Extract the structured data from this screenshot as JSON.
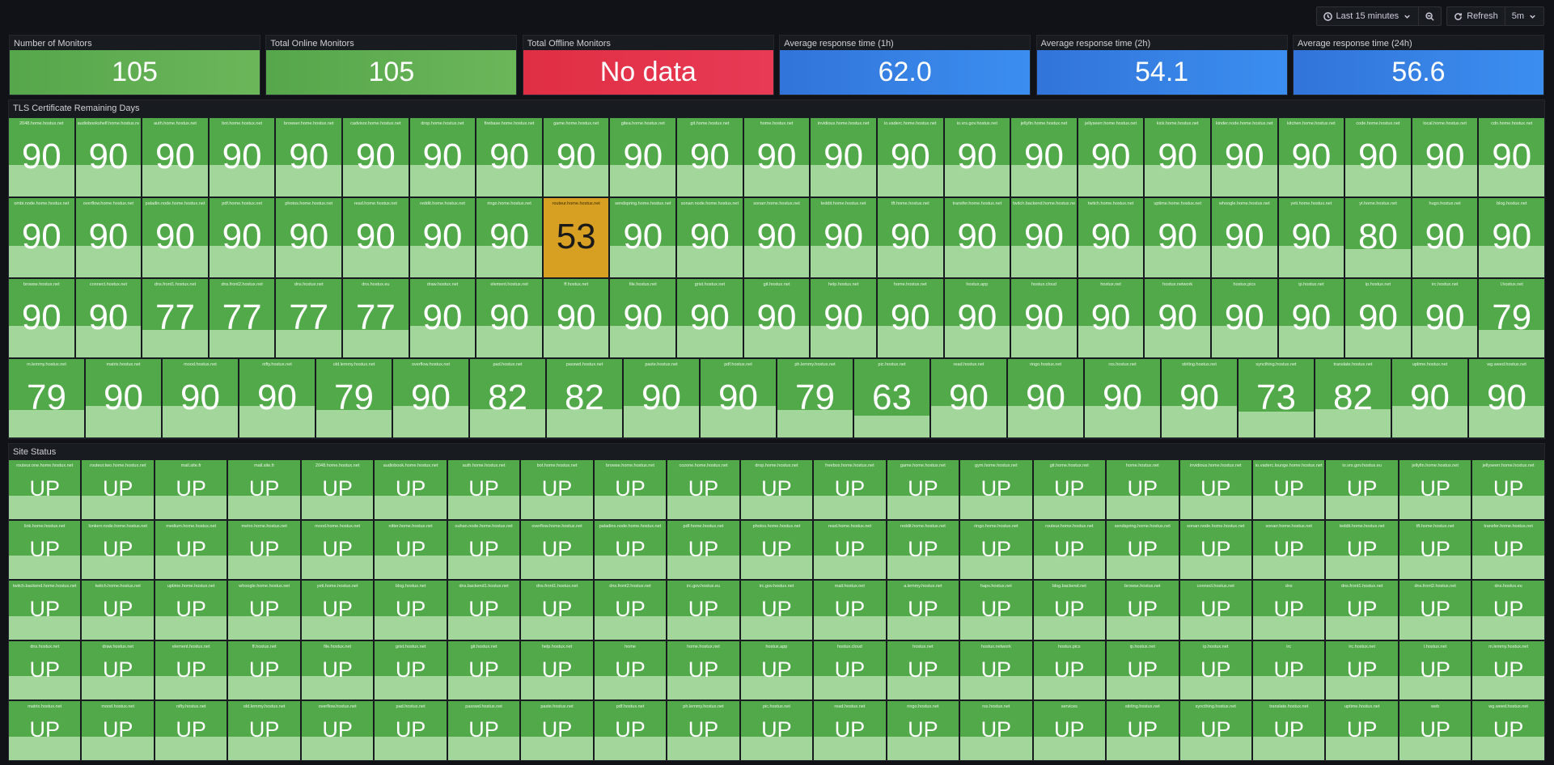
{
  "toolbar": {
    "time_range": "Last 15 minutes",
    "refresh_label": "Refresh",
    "refresh_interval": "5m"
  },
  "stats": [
    {
      "title": "Number of Monitors",
      "value": "105",
      "color": "#56a64b"
    },
    {
      "title": "Total Online Monitors",
      "value": "105",
      "color": "#56a64b"
    },
    {
      "title": "Total Offline Monitors",
      "value": "No data",
      "color": "#e02f44"
    },
    {
      "title": "Average response time (1h)",
      "value": "62.0",
      "color": "#3274d9"
    },
    {
      "title": "Average response time (2h)",
      "value": "54.1",
      "color": "#3274d9"
    },
    {
      "title": "Average response time (24h)",
      "value": "56.6",
      "color": "#3274d9"
    }
  ],
  "tls": {
    "title": "TLS Certificate Remaining Days",
    "rows": [
      [
        {
          "n": "2048.home.hostux.net",
          "v": "90"
        },
        {
          "n": "audiobookshelf.home.hostux.net",
          "v": "90"
        },
        {
          "n": "auth.home.hostux.net",
          "v": "90"
        },
        {
          "n": "bot.home.hostux.net",
          "v": "90"
        },
        {
          "n": "browser.home.hostux.net",
          "v": "90"
        },
        {
          "n": "cadvisor.home.hostux.net",
          "v": "90"
        },
        {
          "n": "drop.home.hostux.net",
          "v": "90"
        },
        {
          "n": "firebase.home.hostux.net",
          "v": "90"
        },
        {
          "n": "game.home.hostux.net",
          "v": "90"
        },
        {
          "n": "gitea.home.hostux.net",
          "v": "90"
        },
        {
          "n": "git.home.hostux.net",
          "v": "90"
        },
        {
          "n": "home.hostux.net",
          "v": "90"
        },
        {
          "n": "invidious.home.hostux.net",
          "v": "90"
        },
        {
          "n": "io.vaderc.home.hostux.net",
          "v": "90"
        },
        {
          "n": "io.vrs.gov.hostux.net",
          "v": "90"
        },
        {
          "n": "jellyfin.home.hostux.net",
          "v": "90"
        },
        {
          "n": "jellyseerr.home.hostux.net",
          "v": "90"
        },
        {
          "n": "kick.home.hostux.net",
          "v": "90"
        },
        {
          "n": "kinder.node.home.hostux.net",
          "v": "90"
        },
        {
          "n": "kitchen.home.hostux.net",
          "v": "90"
        },
        {
          "n": "code.home.hostux.net",
          "v": "90"
        },
        {
          "n": "local.home.hostux.net",
          "v": "90"
        },
        {
          "n": "cdn.home.hostux.net",
          "v": "90"
        }
      ],
      [
        {
          "n": "ombi.node.home.hostux.net",
          "v": "90"
        },
        {
          "n": "overflow.home.hostux.net",
          "v": "90"
        },
        {
          "n": "paladin.node.home.hostux.net",
          "v": "90"
        },
        {
          "n": "pdf.home.hostux.net",
          "v": "90"
        },
        {
          "n": "photos.home.hostux.net",
          "v": "90"
        },
        {
          "n": "read.home.hostux.net",
          "v": "90"
        },
        {
          "n": "reddit.home.hostux.net",
          "v": "90"
        },
        {
          "n": "ringo.home.hostux.net",
          "v": "90"
        },
        {
          "n": "routeur.home.hostux.net",
          "v": "53"
        },
        {
          "n": "sendspring.home.hostux.net",
          "v": "90"
        },
        {
          "n": "sonarr.node.home.hostux.net",
          "v": "90"
        },
        {
          "n": "sonarr.home.hostux.net",
          "v": "90"
        },
        {
          "n": "teddit.home.hostux.net",
          "v": "90"
        },
        {
          "n": "tft.home.hostux.net",
          "v": "90"
        },
        {
          "n": "transfer.home.hostux.net",
          "v": "90"
        },
        {
          "n": "twitch.backend.home.hostux.net",
          "v": "90"
        },
        {
          "n": "twitch.home.hostux.net",
          "v": "90"
        },
        {
          "n": "uptime.home.hostux.net",
          "v": "90"
        },
        {
          "n": "whoogle.home.hostux.net",
          "v": "90"
        },
        {
          "n": "yeti.home.hostux.net",
          "v": "90"
        },
        {
          "n": "yt.home.hostux.net",
          "v": "80"
        },
        {
          "n": "hugo.hostux.net",
          "v": "90"
        },
        {
          "n": "blog.hostux.net",
          "v": "90"
        }
      ],
      [
        {
          "n": "browse.hostux.net",
          "v": "90"
        },
        {
          "n": "connect.hostux.net",
          "v": "90"
        },
        {
          "n": "dns.front1.hostux.net",
          "v": "77"
        },
        {
          "n": "dns.front2.hostux.net",
          "v": "77"
        },
        {
          "n": "dns.hostux.net",
          "v": "77"
        },
        {
          "n": "dns.hostux.eu",
          "v": "77"
        },
        {
          "n": "draw.hostux.net",
          "v": "90"
        },
        {
          "n": "element.hostux.net",
          "v": "90"
        },
        {
          "n": "ff.hostux.net",
          "v": "90"
        },
        {
          "n": "file.hostux.net",
          "v": "90"
        },
        {
          "n": "grist.hostux.net",
          "v": "90"
        },
        {
          "n": "git.hostux.net",
          "v": "90"
        },
        {
          "n": "help.hostux.net",
          "v": "90"
        },
        {
          "n": "home.hostux.net",
          "v": "90"
        },
        {
          "n": "hostux.app",
          "v": "90"
        },
        {
          "n": "hostux.cloud",
          "v": "90"
        },
        {
          "n": "hostux.net",
          "v": "90"
        },
        {
          "n": "hostux.network",
          "v": "90"
        },
        {
          "n": "hostux.pics",
          "v": "90"
        },
        {
          "n": "ip.hostux.net",
          "v": "90"
        },
        {
          "n": "ip.hostux.net",
          "v": "90"
        },
        {
          "n": "irc.hostux.net",
          "v": "90"
        },
        {
          "n": "l.hostux.net",
          "v": "79"
        }
      ],
      [
        {
          "n": "m.lemmy.hostux.net",
          "v": "79"
        },
        {
          "n": "matrix.hostux.net",
          "v": "90"
        },
        {
          "n": "mood.hostux.net",
          "v": "90"
        },
        {
          "n": "nifty.hostux.net",
          "v": "90"
        },
        {
          "n": "old.lemmy.hostux.net",
          "v": "79"
        },
        {
          "n": "overflow.hostux.net",
          "v": "90"
        },
        {
          "n": "pad.hostux.net",
          "v": "82"
        },
        {
          "n": "passwd.hostux.net",
          "v": "82"
        },
        {
          "n": "paste.hostux.net",
          "v": "90"
        },
        {
          "n": "pdf.hostux.net",
          "v": "90"
        },
        {
          "n": "ph.lemmy.hostux.net",
          "v": "79"
        },
        {
          "n": "pic.hostux.net",
          "v": "63"
        },
        {
          "n": "read.hostux.net",
          "v": "90"
        },
        {
          "n": "ringo.hostux.net",
          "v": "90"
        },
        {
          "n": "rss.hostux.net",
          "v": "90"
        },
        {
          "n": "stirling.hostux.net",
          "v": "90"
        },
        {
          "n": "syncthing.hostux.net",
          "v": "73"
        },
        {
          "n": "translate.hostux.net",
          "v": "82"
        },
        {
          "n": "uptime.hostux.net",
          "v": "90"
        },
        {
          "n": "wg.weed.hostux.net",
          "v": "90"
        }
      ]
    ]
  },
  "site_status": {
    "title": "Site Status",
    "rows": [
      [
        {
          "n": "routeur.one.home.hostux.net",
          "v": "UP"
        },
        {
          "n": "routeur.two.home.hostux.net",
          "v": "UP"
        },
        {
          "n": "mail.site.fr",
          "v": "UP"
        },
        {
          "n": "mail.site.fr",
          "v": "UP"
        },
        {
          "n": "2048.home.hostux.net",
          "v": "UP"
        },
        {
          "n": "audiobook.home.hostux.net",
          "v": "UP"
        },
        {
          "n": "auth.home.hostux.net",
          "v": "UP"
        },
        {
          "n": "bot.home.hostux.net",
          "v": "UP"
        },
        {
          "n": "browse.home.hostux.net",
          "v": "UP"
        },
        {
          "n": "cozone.home.hostux.net",
          "v": "UP"
        },
        {
          "n": "drop.home.hostux.net",
          "v": "UP"
        },
        {
          "n": "freebox.home.hostux.net",
          "v": "UP"
        },
        {
          "n": "game.home.hostux.net",
          "v": "UP"
        },
        {
          "n": "gym.home.hostux.net",
          "v": "UP"
        },
        {
          "n": "git.home.hostux.net",
          "v": "UP"
        },
        {
          "n": "home.hostux.net",
          "v": "UP"
        },
        {
          "n": "invidious.home.hostux.net",
          "v": "UP"
        },
        {
          "n": "io.vaderc.lounge.home.hostux.net",
          "v": "UP"
        },
        {
          "n": "io.vrs.gov.hostux.eu",
          "v": "UP"
        },
        {
          "n": "jellyfin.home.hostux.net",
          "v": "UP"
        },
        {
          "n": "jellyseerr.home.hostux.net",
          "v": "UP"
        }
      ],
      [
        {
          "n": "link.home.hostux.net",
          "v": "UP"
        },
        {
          "n": "lonkerr.node.home.hostux.net",
          "v": "UP"
        },
        {
          "n": "medium.home.hostux.net",
          "v": "UP"
        },
        {
          "n": "metro.home.hostux.net",
          "v": "UP"
        },
        {
          "n": "mood.home.hostux.net",
          "v": "UP"
        },
        {
          "n": "nitter.home.hostux.net",
          "v": "UP"
        },
        {
          "n": "ouhan.node.home.hostux.net",
          "v": "UP"
        },
        {
          "n": "overflow.home.hostux.net",
          "v": "UP"
        },
        {
          "n": "paladins.node.home.hostux.net",
          "v": "UP"
        },
        {
          "n": "pdf.home.hostux.net",
          "v": "UP"
        },
        {
          "n": "photos.home.hostux.net",
          "v": "UP"
        },
        {
          "n": "read.home.hostux.net",
          "v": "UP"
        },
        {
          "n": "reddit.home.hostux.net",
          "v": "UP"
        },
        {
          "n": "ringo.home.hostux.net",
          "v": "UP"
        },
        {
          "n": "routeur.home.hostux.net",
          "v": "UP"
        },
        {
          "n": "sendspring.home.hostux.net",
          "v": "UP"
        },
        {
          "n": "sonarr.node.home.hostux.net",
          "v": "UP"
        },
        {
          "n": "sonarr.home.hostux.net",
          "v": "UP"
        },
        {
          "n": "teddit.home.hostux.net",
          "v": "UP"
        },
        {
          "n": "tft.home.hostux.net",
          "v": "UP"
        },
        {
          "n": "transfer.home.hostux.net",
          "v": "UP"
        }
      ],
      [
        {
          "n": "twitch.backend.home.hostux.net",
          "v": "UP"
        },
        {
          "n": "twitch.home.hostux.net",
          "v": "UP"
        },
        {
          "n": "uptime.home.hostux.net",
          "v": "UP"
        },
        {
          "n": "whoogle.home.hostux.net",
          "v": "UP"
        },
        {
          "n": "yeti.home.hostux.net",
          "v": "UP"
        },
        {
          "n": "blog.hostux.net",
          "v": "UP"
        },
        {
          "n": "dns.backend1.hostux.net",
          "v": "UP"
        },
        {
          "n": "dns.front1.hostux.net",
          "v": "UP"
        },
        {
          "n": "dns.front2.hostux.net",
          "v": "UP"
        },
        {
          "n": "irc.gov.hostux.eu",
          "v": "UP"
        },
        {
          "n": "irc.gov.hostux.net",
          "v": "UP"
        },
        {
          "n": "mail.hostux.net",
          "v": "UP"
        },
        {
          "n": "a.lemmy.hostux.net",
          "v": "UP"
        },
        {
          "n": "haps.hostux.net",
          "v": "UP"
        },
        {
          "n": "blog.backend.net",
          "v": "UP"
        },
        {
          "n": "browse.hostux.net",
          "v": "UP"
        },
        {
          "n": "connect.hostux.net",
          "v": "UP"
        },
        {
          "n": "dns",
          "v": "UP"
        },
        {
          "n": "dns.front1.hostux.net",
          "v": "UP"
        },
        {
          "n": "dns.front2.hostux.net",
          "v": "UP"
        },
        {
          "n": "dns.hostux.eu",
          "v": "UP"
        }
      ],
      [
        {
          "n": "dns.hostux.net",
          "v": "UP"
        },
        {
          "n": "draw.hostux.net",
          "v": "UP"
        },
        {
          "n": "element.hostux.net",
          "v": "UP"
        },
        {
          "n": "ff.hostux.net",
          "v": "UP"
        },
        {
          "n": "file.hostux.net",
          "v": "UP"
        },
        {
          "n": "grist.hostux.net",
          "v": "UP"
        },
        {
          "n": "git.hostux.net",
          "v": "UP"
        },
        {
          "n": "help.hostux.net",
          "v": "UP"
        },
        {
          "n": "home",
          "v": "UP"
        },
        {
          "n": "home.hostux.net",
          "v": "UP"
        },
        {
          "n": "hostux.app",
          "v": "UP"
        },
        {
          "n": "hostux.cloud",
          "v": "UP"
        },
        {
          "n": "hostux.net",
          "v": "UP"
        },
        {
          "n": "hostux.network",
          "v": "UP"
        },
        {
          "n": "hostux.pics",
          "v": "UP"
        },
        {
          "n": "ip.hostux.net",
          "v": "UP"
        },
        {
          "n": "ip.hostux.net",
          "v": "UP"
        },
        {
          "n": "irc",
          "v": "UP"
        },
        {
          "n": "irc.hostux.net",
          "v": "UP"
        },
        {
          "n": "l.hostux.net",
          "v": "UP"
        },
        {
          "n": "m.lemmy.hostux.net",
          "v": "UP"
        }
      ],
      [
        {
          "n": "matrix.hostux.net",
          "v": "UP"
        },
        {
          "n": "mood.hostux.net",
          "v": "UP"
        },
        {
          "n": "nifty.hostux.net",
          "v": "UP"
        },
        {
          "n": "old.lemmy.hostux.net",
          "v": "UP"
        },
        {
          "n": "overflow.hostux.net",
          "v": "UP"
        },
        {
          "n": "pad.hostux.net",
          "v": "UP"
        },
        {
          "n": "passwd.hostux.net",
          "v": "UP"
        },
        {
          "n": "paste.hostux.net",
          "v": "UP"
        },
        {
          "n": "pdf.hostux.net",
          "v": "UP"
        },
        {
          "n": "ph.lemmy.hostux.net",
          "v": "UP"
        },
        {
          "n": "pic.hostux.net",
          "v": "UP"
        },
        {
          "n": "read.hostux.net",
          "v": "UP"
        },
        {
          "n": "ringo.hostux.net",
          "v": "UP"
        },
        {
          "n": "rss.hostux.net",
          "v": "UP"
        },
        {
          "n": "services",
          "v": "UP"
        },
        {
          "n": "stirling.hostux.net",
          "v": "UP"
        },
        {
          "n": "syncthing.hostux.net",
          "v": "UP"
        },
        {
          "n": "translate.hostux.net",
          "v": "UP"
        },
        {
          "n": "uptime.hostux.net",
          "v": "UP"
        },
        {
          "n": "web",
          "v": "UP"
        },
        {
          "n": "wg.weed.hostux.net",
          "v": "UP"
        }
      ]
    ]
  }
}
